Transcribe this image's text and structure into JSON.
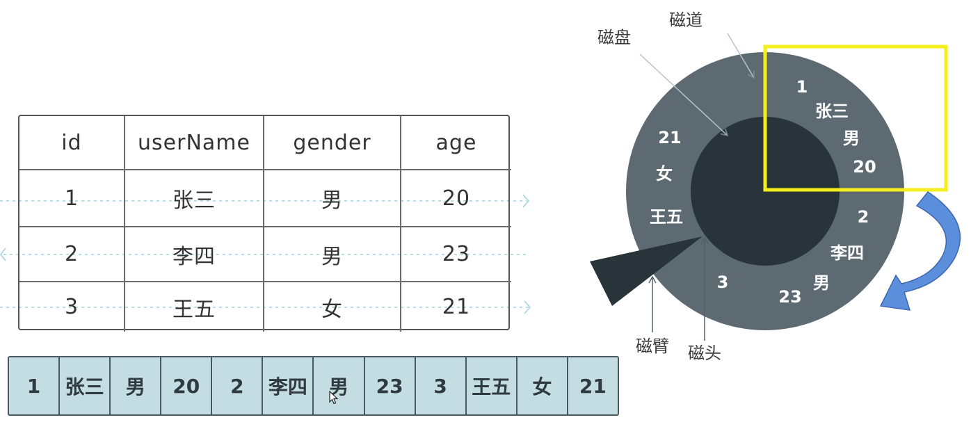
{
  "table": {
    "headers": [
      "id",
      "userName",
      "gender",
      "age"
    ],
    "rows": [
      [
        "1",
        "张三",
        "男",
        "20"
      ],
      [
        "2",
        "李四",
        "男",
        "23"
      ],
      [
        "3",
        "王五",
        "女",
        "21"
      ]
    ]
  },
  "strip": [
    "1",
    "张三",
    "男",
    "20",
    "2",
    "李四",
    "男",
    "23",
    "3",
    "王五",
    "女",
    "21"
  ],
  "disk": {
    "labels": {
      "track": "磁道",
      "platter": "磁盘",
      "arm": "磁臂",
      "head": "磁头"
    },
    "ring_text": {
      "record1": [
        "1",
        "张三",
        "男",
        "20"
      ],
      "record2": [
        "2",
        "李四",
        "男",
        "23"
      ],
      "record3": [
        "3",
        "王五",
        "女",
        "21"
      ]
    }
  },
  "colors": {
    "outer_ring": "#5e6a71",
    "inner_disk": "#28333a",
    "highlight": "#f4ee1d",
    "arrow": "#5b8fdc",
    "strip_fill": "#c4dde2"
  },
  "icons": [
    "mouse-pointer-icon",
    "curved-arrow-icon"
  ]
}
